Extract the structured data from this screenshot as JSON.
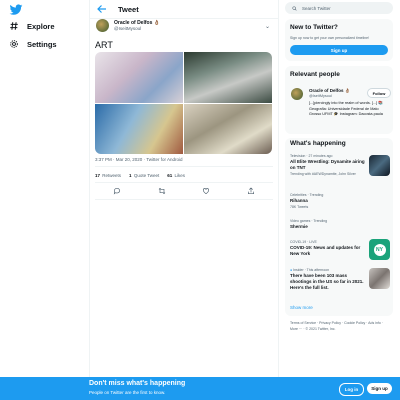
{
  "nav": {
    "explore": "Explore",
    "settings": "Settings"
  },
  "header": {
    "title": "Tweet"
  },
  "tweet": {
    "author_name": "Oracle of Delfos 👌🏽",
    "author_handle": "@IseitMysoul",
    "text": "ART",
    "meta": "3:37 PM · Mar 20, 2020 · Twitter for Android",
    "retweets": "17",
    "retweets_label": "Retweets",
    "quotes": "1",
    "quotes_label": "Quote Tweet",
    "likes": "61",
    "likes_label": "Likes"
  },
  "search": {
    "placeholder": "Search Twitter"
  },
  "new_to_twitter": {
    "title": "New to Twitter?",
    "subtitle": "Sign up now to get your own personalized timeline!",
    "button": "Sign up"
  },
  "relevant": {
    "title": "Relevant people",
    "name": "Oracle of Delfos 👌🏽",
    "handle": "@IseitMysoul",
    "follow": "Follow",
    "bio": "[...]piercingly into the realm of words. [...] 📚 Geografia: Universidade Federal de Mato Grosso UFMT 🎓 Instagram: Dacosta.paula"
  },
  "happening": {
    "title": "What's happening",
    "trends": [
      {
        "meta": "Television · 27 minutes ago",
        "title": "All Elite Wrestling: Dynamite airing on TNT",
        "sub": "Trending with #AEWDynamite, John Silver"
      },
      {
        "meta": "Celebrities · Trending",
        "title": "Rihanna",
        "sub": "78K Tweets"
      },
      {
        "meta": "Video games · Trending",
        "title": "Shermie",
        "sub": ""
      },
      {
        "meta": "COVID-19 · LIVE",
        "title": "COVID-19: News and updates for New York",
        "sub": ""
      },
      {
        "meta": "Insider · This afternoon",
        "title": "There have been 103 mass shootings in the US so far in 2021. Here's the full list.",
        "sub": ""
      }
    ],
    "show_more": "Show more"
  },
  "footer": {
    "links": "Terms of Service · Privacy Policy · Cookie Policy · Ads info · More ··· · © 2021 Twitter, Inc."
  },
  "banner": {
    "title": "Don't miss what's happening",
    "subtitle": "People on Twitter are the first to know.",
    "login": "Log in",
    "signup": "Sign up"
  }
}
